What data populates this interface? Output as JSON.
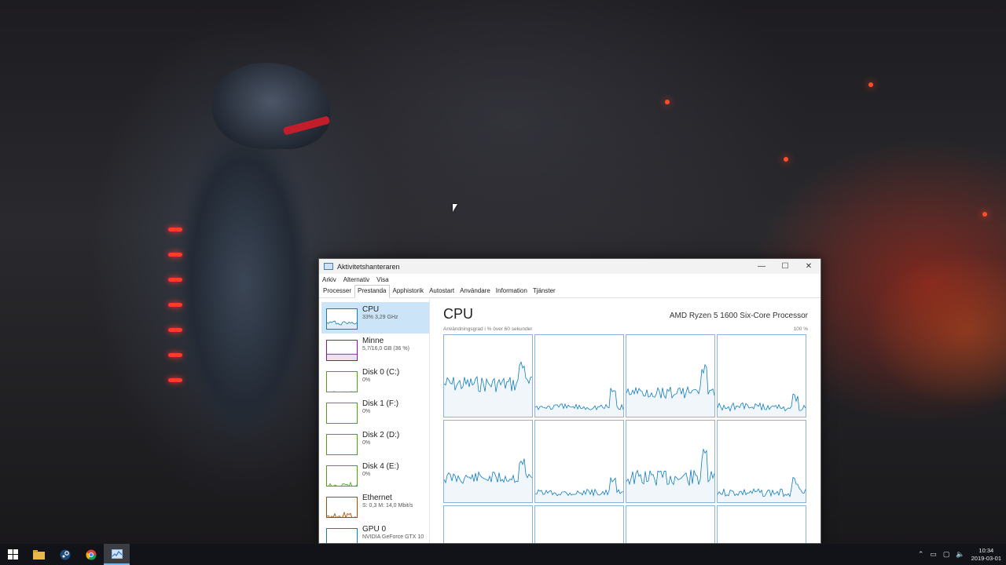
{
  "window": {
    "title": "Aktivitetshanteraren",
    "menu": [
      "Arkiv",
      "Alternativ",
      "Visa"
    ],
    "tabs": [
      "Processer",
      "Prestanda",
      "Apphistorik",
      "Autostart",
      "Användare",
      "Information",
      "Tjänster"
    ],
    "active_tab": "Prestanda"
  },
  "sidebar": {
    "items": [
      {
        "name": "CPU",
        "sub": "33% 3,29 GHz",
        "color": "#117dbb"
      },
      {
        "name": "Minne",
        "sub": "5,7/16,0 GB (36 %)",
        "color": "#8b12ae"
      },
      {
        "name": "Disk 0 (C:)",
        "sub": "0%",
        "color": "#4da60c"
      },
      {
        "name": "Disk 1 (F:)",
        "sub": "0%",
        "color": "#4da60c"
      },
      {
        "name": "Disk 2 (D:)",
        "sub": "0%",
        "color": "#4da60c"
      },
      {
        "name": "Disk 4 (E:)",
        "sub": "0%",
        "color": "#4da60c"
      },
      {
        "name": "Ethernet",
        "sub": "S: 0,3 M: 14,0 Mbit/s",
        "color": "#a74f01"
      },
      {
        "name": "GPU 0",
        "sub": "NVIDIA GeForce GTX 10",
        "color": "#117dbb"
      }
    ]
  },
  "main": {
    "heading": "CPU",
    "processor": "AMD Ryzen 5 1600 Six-Core Processor",
    "axis_left": "Användningsgrad i % över 60 sekunder",
    "axis_right": "100 %",
    "line_color": "#117dbb",
    "fill_color": "#f1f6fa"
  },
  "taskbar": {
    "apps": [
      "windows-start",
      "file-explorer",
      "steam",
      "chrome",
      "task-manager"
    ],
    "time": "10:34",
    "date": "2019-03-01"
  }
}
